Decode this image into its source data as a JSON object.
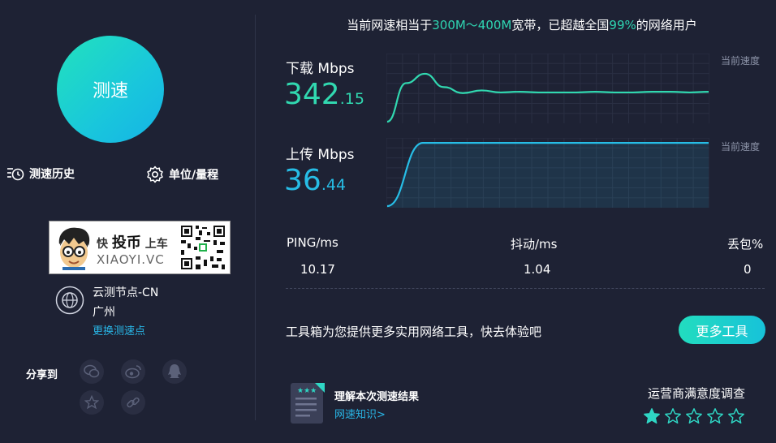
{
  "start_button": {
    "label": "测速"
  },
  "history_link": {
    "label": "测速历史",
    "icon": "history-icon"
  },
  "unit_link": {
    "label": "单位/量程",
    "icon": "gear-icon"
  },
  "promo": {
    "text_prefix": "快",
    "text_big": "投币",
    "text_suffix": "上车",
    "domain": "XIAOYI.VC"
  },
  "node": {
    "name": "云测节点-CN",
    "city": "广州",
    "change_label": "更换测速点"
  },
  "share": {
    "label": "分享到",
    "icons": [
      "wechat-icon",
      "weibo-icon",
      "qq-icon",
      "favorite-icon",
      "link-icon"
    ]
  },
  "summary": {
    "pre": "当前网速相当于",
    "band": "300M～400M",
    "mid": "宽带，已超越全国",
    "pct": "99%",
    "post": "的网络用户"
  },
  "download": {
    "label": "下载 Mbps",
    "int": "342",
    "frac": ".15",
    "current_label": "当前速度",
    "color": "#31d8b0"
  },
  "upload": {
    "label": "上传 Mbps",
    "int": "36",
    "frac": ".44",
    "current_label": "当前速度",
    "color": "#27bde6"
  },
  "stats": {
    "ping": {
      "label": "PING/ms",
      "value": "10.17"
    },
    "jitter": {
      "label": "抖动/ms",
      "value": "1.04"
    },
    "loss": {
      "label": "丢包%",
      "value": "0"
    }
  },
  "toolbox": {
    "text": "工具箱为您提供更多实用网络工具，快去体验吧",
    "button": "更多工具"
  },
  "knowledge": {
    "title": "理解本次测速结果",
    "link": "网速知识>"
  },
  "survey": {
    "title": "运营商满意度调查",
    "rating": 1,
    "max": 5
  },
  "chart_data": [
    {
      "type": "line",
      "series": [
        {
          "name": "下载",
          "values": [
            0.0,
            0.58,
            0.72,
            0.52,
            0.43,
            0.47,
            0.44,
            0.45,
            0.44,
            0.44,
            0.44,
            0.45,
            0.44,
            0.44,
            0.45,
            0.45,
            0.44,
            0.45
          ]
        }
      ]
    },
    {
      "type": "area",
      "series": [
        {
          "name": "上传",
          "values": [
            0.0,
            0.95,
            0.95,
            0.95,
            0.95,
            0.95,
            0.95,
            0.95,
            0.95,
            0.95
          ]
        }
      ]
    }
  ]
}
